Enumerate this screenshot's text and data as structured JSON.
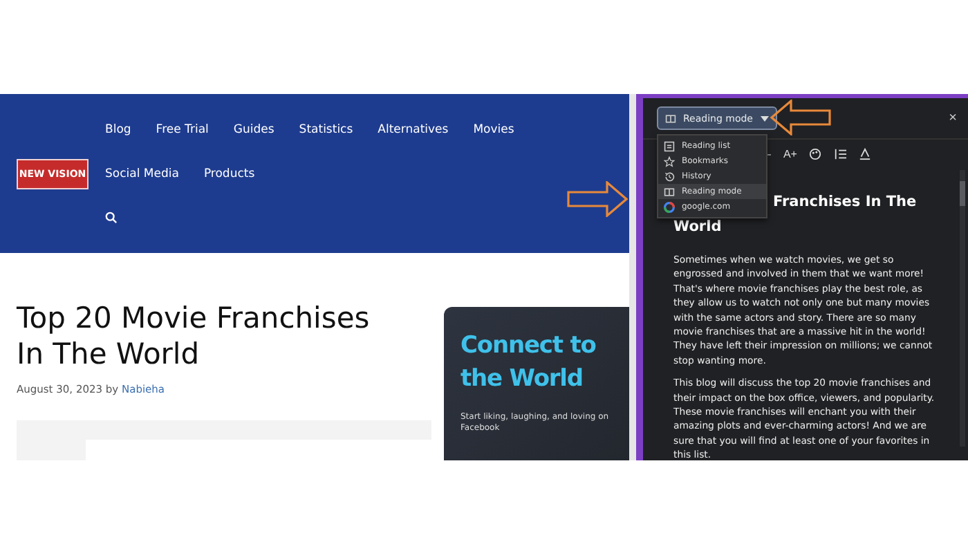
{
  "site": {
    "logo": "NEW VISION",
    "nav_rows": [
      [
        "Blog",
        "Free Trial",
        "Guides",
        "Statistics",
        "Alternatives",
        "Movies"
      ],
      [
        "Social Media",
        "Products"
      ]
    ],
    "article": {
      "title": "Top 20 Movie Franchises In The World",
      "date": "August 30, 2023",
      "by": "by",
      "author": "Nabieha"
    },
    "promo": {
      "heading": "Connect to the World",
      "text": "Start liking, laughing, and loving on Facebook"
    }
  },
  "reader": {
    "mode_button": "Reading mode",
    "close": "×",
    "menu": [
      {
        "label": "Reading list",
        "selected": false
      },
      {
        "label": "Bookmarks",
        "selected": false
      },
      {
        "label": "History",
        "selected": false
      },
      {
        "label": "Reading mode",
        "selected": true
      },
      {
        "label": "google.com",
        "selected": false
      }
    ],
    "toolbar": [
      "–",
      "A+"
    ],
    "heading_lines": [
      "Franchises In The",
      "World"
    ],
    "paragraphs": [
      "Sometimes when we watch movies, we get so engrossed and involved in them that we want more! That's where movie franchises play the best role, as they allow us to watch not only one but many movies with the same actors and story. There are so many movie franchises that are a massive hit in the world! They have left their impression on millions; we cannot stop wanting more.",
      "This blog will discuss the top 20 movie franchises and their impact on the box office, viewers, and popularity. These movie franchises will enchant you with their amazing plots and ever-charming actors! And we are sure that you will find at least one of your favorites in this list."
    ]
  },
  "annotations": [
    {
      "kind": "arrow"
    },
    {
      "kind": "arrow"
    }
  ]
}
